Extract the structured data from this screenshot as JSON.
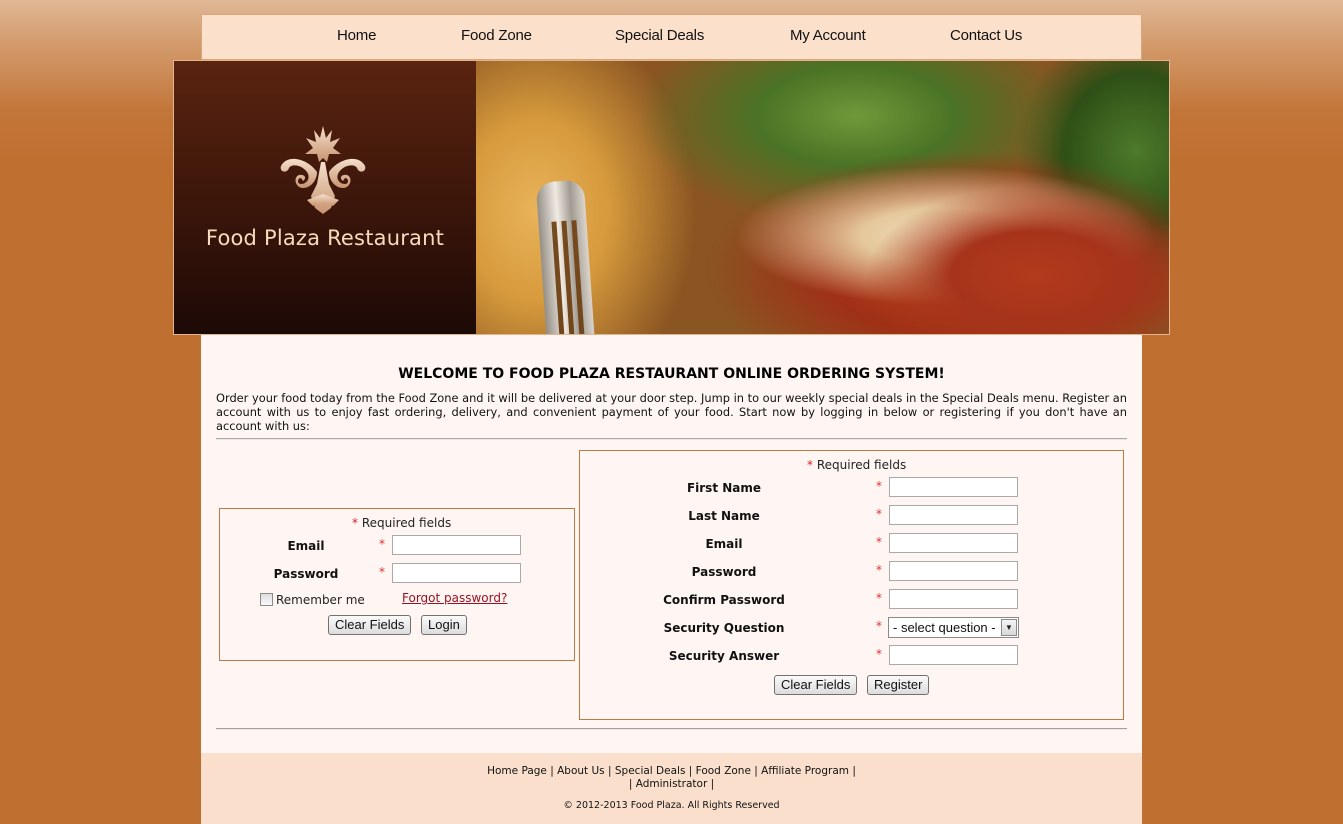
{
  "nav": {
    "items": [
      {
        "label": "Home"
      },
      {
        "label": "Food Zone"
      },
      {
        "label": "Special Deals"
      },
      {
        "label": "My Account"
      },
      {
        "label": "Contact Us"
      }
    ]
  },
  "banner": {
    "title": "Food Plaza Restaurant",
    "logo_icon": "ornamental-lily-icon",
    "image": "lasagna-photo"
  },
  "main": {
    "heading": "WELCOME TO FOOD PLAZA RESTAURANT ONLINE ORDERING SYSTEM!",
    "intro": "Order your food today from the Food Zone and it will be delivered at your door step. Jump in to our weekly special deals in the Special Deals menu. Register an account with us to enjoy fast ordering, delivery, and convenient payment of your food. Start now by logging in below or registering if you don't have an account with us:"
  },
  "login": {
    "required_star": "*",
    "required_note": "Required fields",
    "email_label": "Email",
    "email_value": "",
    "password_label": "Password",
    "password_value": "",
    "remember_label": "Remember me",
    "remember_checked": false,
    "forgot_link": "Forgot password?",
    "clear_button": "Clear Fields",
    "login_button": "Login"
  },
  "register": {
    "required_star": "*",
    "required_note": "Required fields",
    "fields": [
      {
        "label": "First Name",
        "value": ""
      },
      {
        "label": "Last Name",
        "value": ""
      },
      {
        "label": "Email",
        "value": ""
      },
      {
        "label": "Password",
        "value": ""
      },
      {
        "label": "Confirm Password",
        "value": ""
      },
      {
        "label": "Security Question",
        "value": "- select question -"
      },
      {
        "label": "Security Answer",
        "value": ""
      }
    ],
    "clear_button": "Clear Fields",
    "register_button": "Register"
  },
  "footer": {
    "links": [
      "Home Page",
      "About Us",
      "Special Deals",
      "Food Zone",
      "Affiliate Program",
      "Administrator"
    ],
    "separator": "|",
    "copyright": "© 2012-2013 Food Plaza. All Rights Reserved"
  },
  "colors": {
    "background": "#bf6f30",
    "nav_bg": "#fbe0cc",
    "content_bg": "#fff6f3",
    "box_border": "#b97a45",
    "required_star": "#d61f1f",
    "link": "#9b0f1f",
    "logo_panel": "#3a150a",
    "logo_text": "#f7dcbc"
  }
}
